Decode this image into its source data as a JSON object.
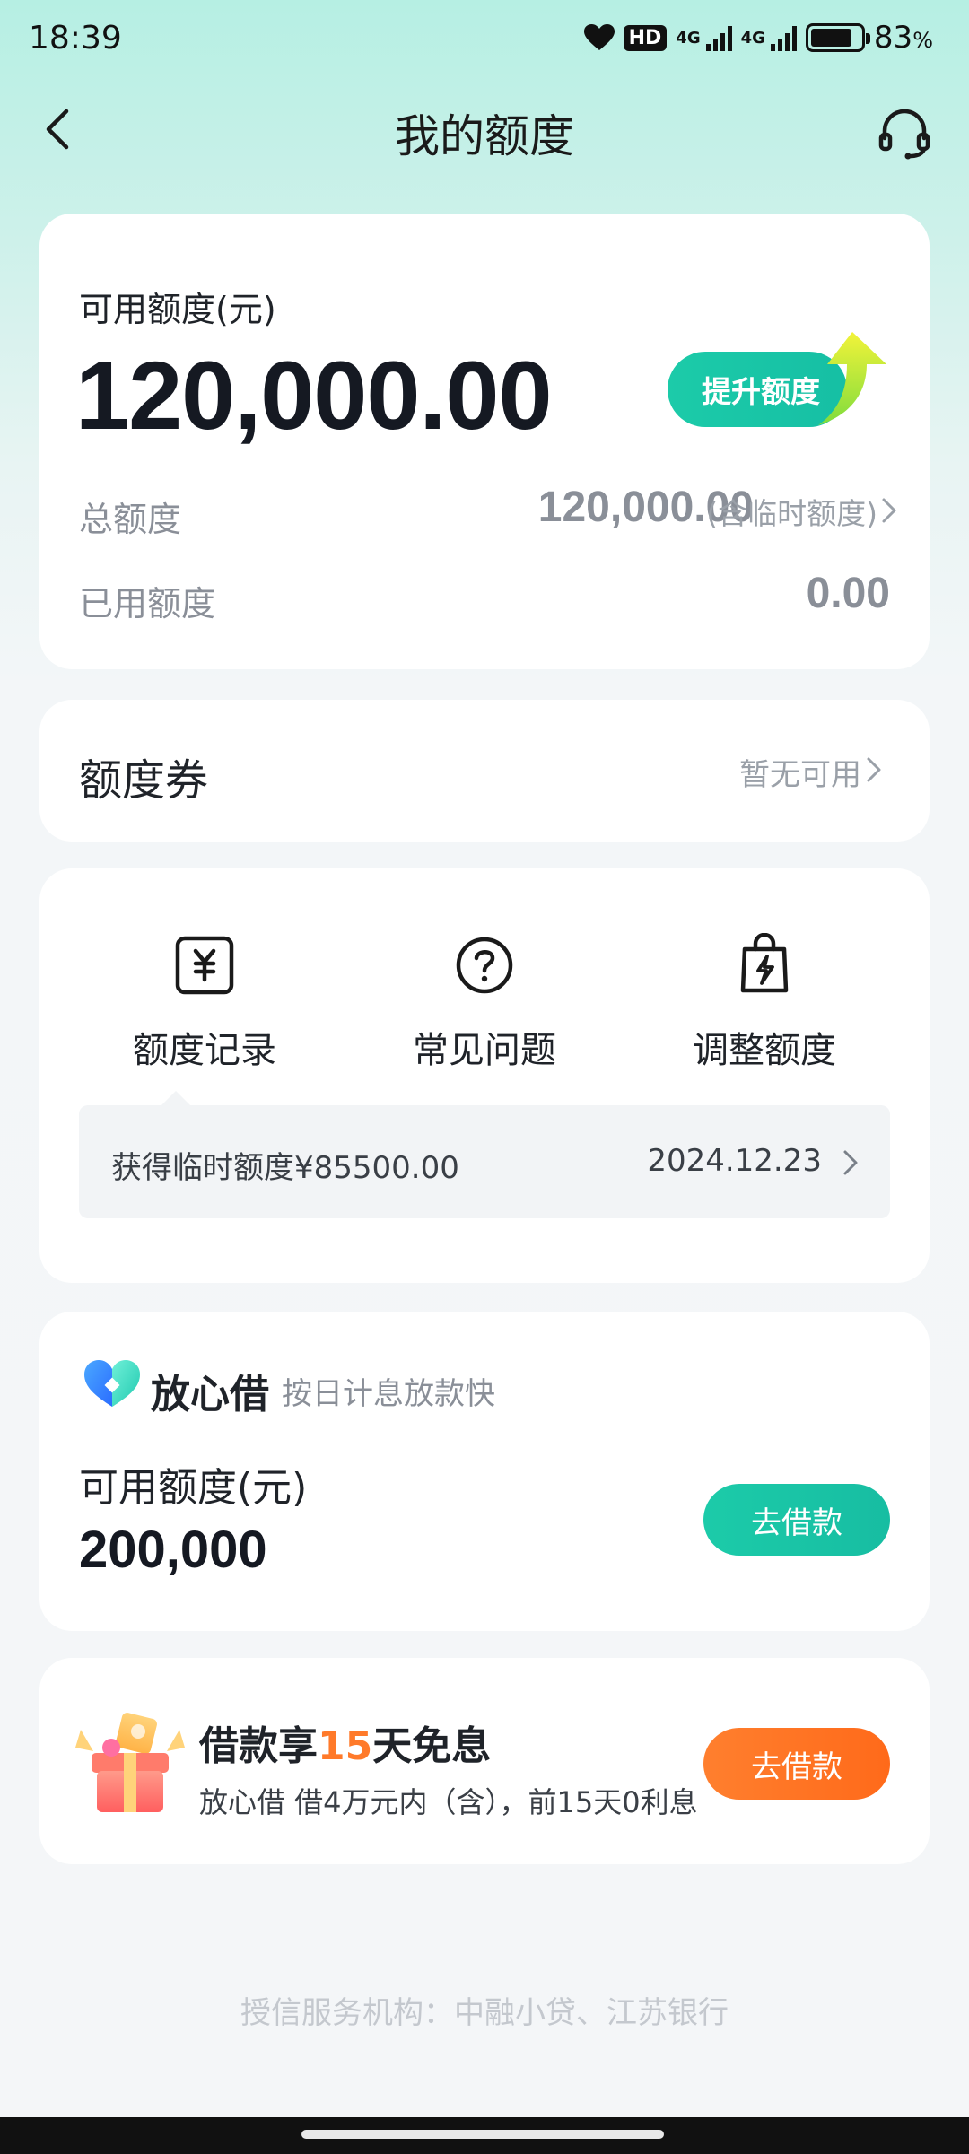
{
  "status_bar": {
    "time": "18:39",
    "hd": "HD",
    "net1": "4G",
    "net2": "4G",
    "battery_percent": "83",
    "battery_unit": "%"
  },
  "nav": {
    "title": "我的额度",
    "back_icon": "chevron-left-icon",
    "service_icon": "headset-icon"
  },
  "quota": {
    "available_label": "可用额度(元)",
    "available_amount": "120,000.00",
    "raise_button": "提升额度",
    "total_label": "总额度",
    "total_value": "120,000.00",
    "total_note": "(含临时额度)",
    "used_label": "已用额度",
    "used_value": "0.00"
  },
  "coupon": {
    "title": "额度券",
    "status": "暂无可用"
  },
  "tools": {
    "items": [
      {
        "label": "额度记录",
        "icon": "yuan-receipt-icon"
      },
      {
        "label": "常见问题",
        "icon": "question-circle-icon"
      },
      {
        "label": "调整额度",
        "icon": "lightning-bag-icon"
      }
    ],
    "notice_text": "获得临时额度¥85500.00",
    "notice_date": "2024.12.23"
  },
  "fangxinjie": {
    "brand": "放心借",
    "slogan": "按日计息放款快",
    "available_label": "可用额度(元)",
    "available_amount": "200,000",
    "button": "去借款"
  },
  "promo": {
    "title_prefix": "借款享",
    "title_highlight": "15",
    "title_suffix": "天免息",
    "description": "放心借 借4万元内（含），前15天0利息",
    "button": "去借款"
  },
  "footer": {
    "text": "授信服务机构：中融小贷、江苏银行"
  },
  "colors": {
    "brand_green": "#1ccba9",
    "accent_orange": "#ff7a2a"
  }
}
